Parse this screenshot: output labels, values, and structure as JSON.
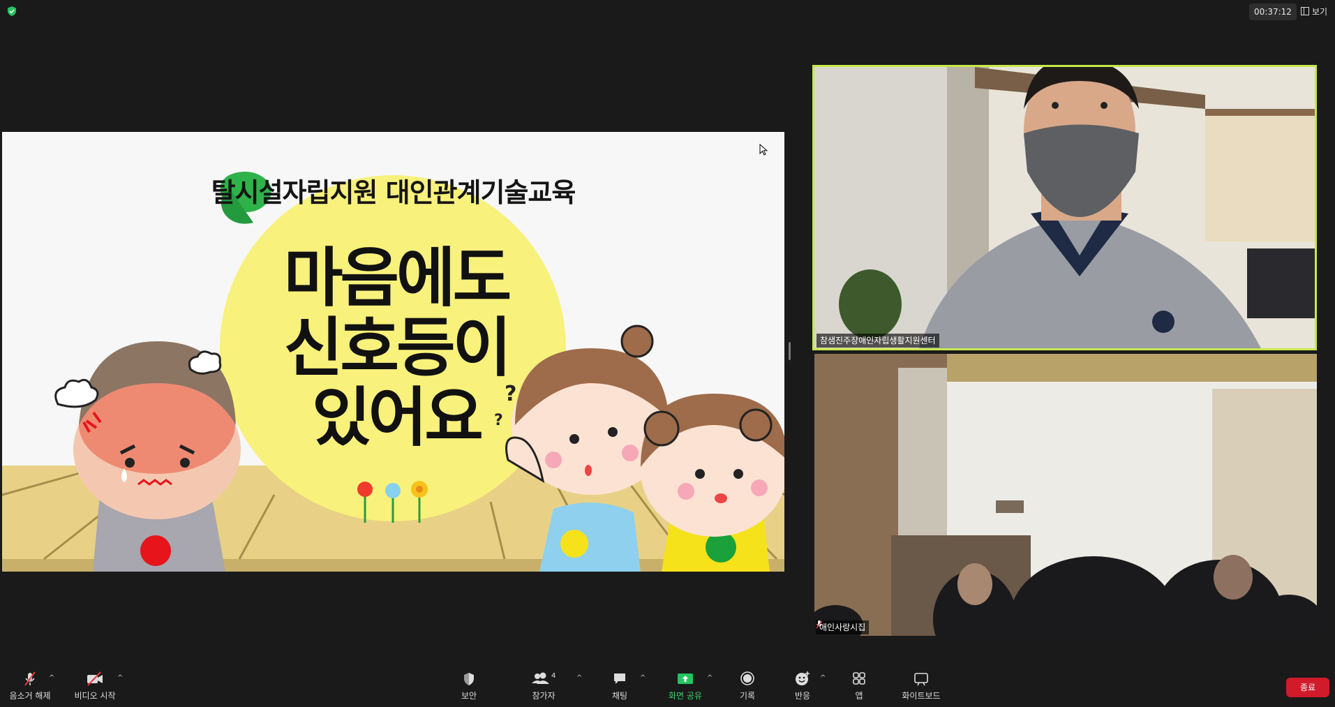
{
  "topbar": {
    "timer": "00:37:12",
    "view_label": "보기",
    "shield_icon": "shield-check-icon",
    "shield_color": "#23c45e"
  },
  "share": {
    "title": "탈시설자립지원 대인관계기술교육",
    "main_lines": [
      "마음에도",
      "신호등이",
      "있어요"
    ],
    "circle_color": "#f8f17b",
    "floor_color": "#e8d186"
  },
  "participants": [
    {
      "name": "참샘진주장애인자립생활지원센터",
      "active_speaker": true,
      "accent": "#c8e84a"
    },
    {
      "name": "애인사랑시집",
      "muted": true
    }
  ],
  "toolbar": {
    "mute": "음소거 해제",
    "video": "비디오 시작",
    "security": "보안",
    "participants": "참가자",
    "participants_count": "4",
    "chat": "채팅",
    "share": "화면 공유",
    "record": "기록",
    "reactions": "반응",
    "apps": "앱",
    "whiteboard": "화이트보드",
    "end": "종료",
    "share_color": "#23c45e",
    "end_color": "#d11a2a"
  }
}
